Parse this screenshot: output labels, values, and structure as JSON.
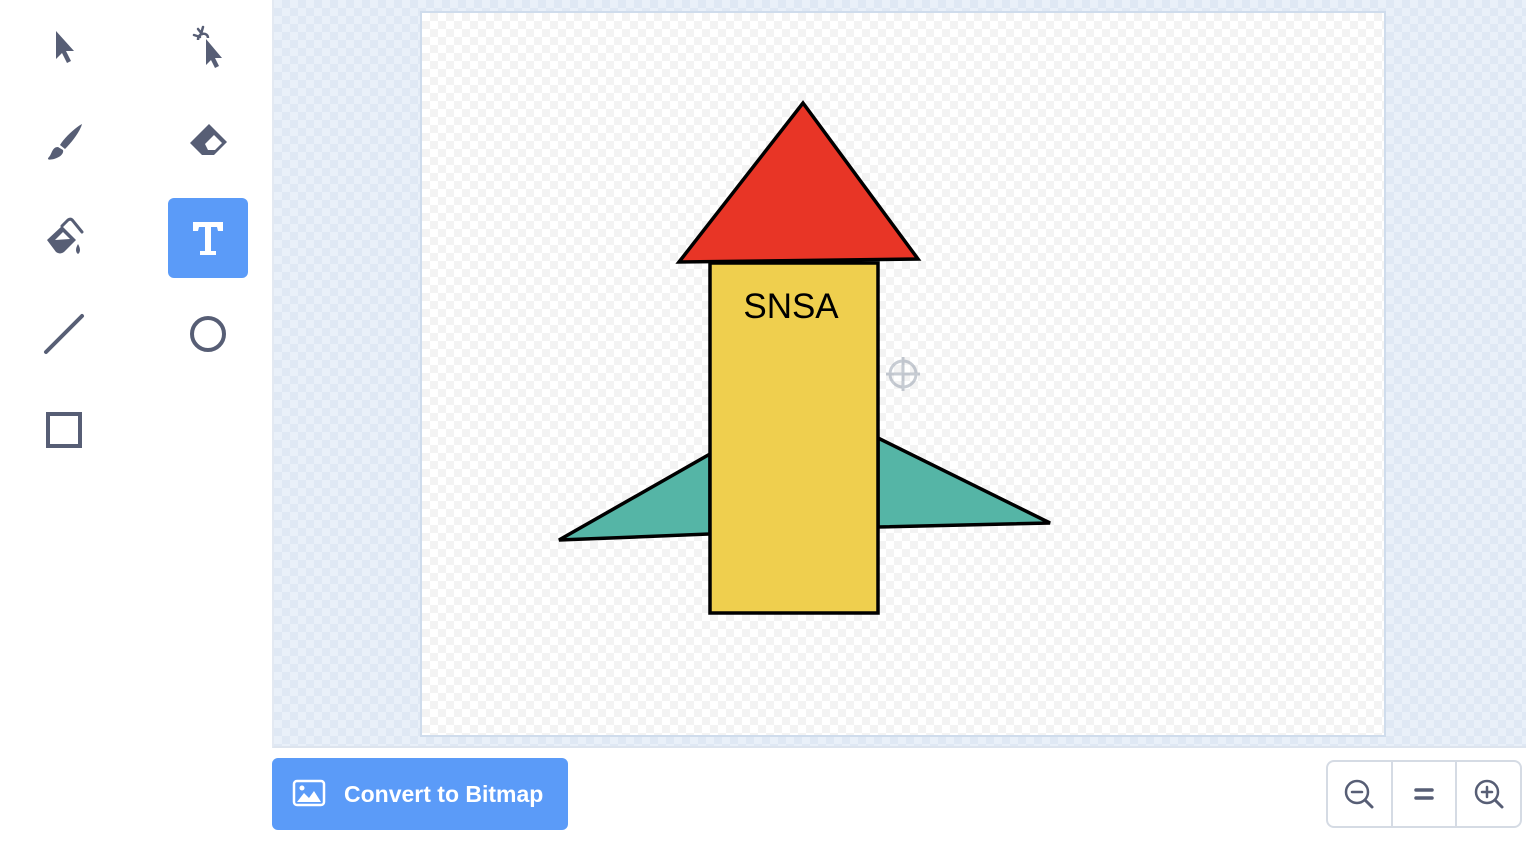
{
  "toolbar": {
    "tools": [
      {
        "name": "select",
        "icon": "select-arrow-icon"
      },
      {
        "name": "reshape",
        "icon": "reshape-icon"
      },
      {
        "name": "brush",
        "icon": "brush-icon"
      },
      {
        "name": "eraser",
        "icon": "eraser-icon"
      },
      {
        "name": "fill",
        "icon": "fill-bucket-icon"
      },
      {
        "name": "text",
        "icon": "text-icon",
        "selected": true
      },
      {
        "name": "line",
        "icon": "line-icon"
      },
      {
        "name": "circle",
        "icon": "circle-icon"
      },
      {
        "name": "rectangle",
        "icon": "rectangle-icon"
      }
    ]
  },
  "canvas": {
    "rocket_text": "SNSA",
    "colors": {
      "nose": "#e83526",
      "body": "#efcf4e",
      "fins": "#55b5a6",
      "outline": "#000000"
    }
  },
  "bottom_bar": {
    "convert_label": "Convert to Bitmap",
    "convert_icon": "bitmap-image-icon",
    "zoom_out_icon": "zoom-out-icon",
    "zoom_reset_icon": "zoom-reset-icon",
    "zoom_in_icon": "zoom-in-icon"
  },
  "theme": {
    "accent": "#5b9bf8",
    "icon_color": "#575e75"
  }
}
